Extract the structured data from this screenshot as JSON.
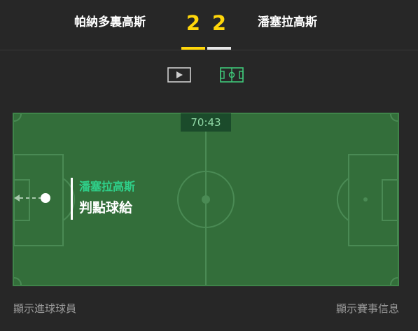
{
  "match": {
    "home_team": "帕納多裏高斯",
    "away_team": "潘塞拉高斯",
    "home_score": "2",
    "away_score": "2"
  },
  "views": {
    "video_icon": "play-icon",
    "pitch_icon": "pitch-icon",
    "active": "pitch"
  },
  "pitch": {
    "clock": "70:43",
    "event": {
      "team": "潘塞拉高斯",
      "description": "判點球給"
    }
  },
  "footer": {
    "show_scorers": "顯示進球球員",
    "show_match_info": "顯示賽事信息"
  },
  "colors": {
    "background": "#272727",
    "score": "#ffd60a",
    "pitch": "#336e3a",
    "event_team": "#2fd08a"
  }
}
